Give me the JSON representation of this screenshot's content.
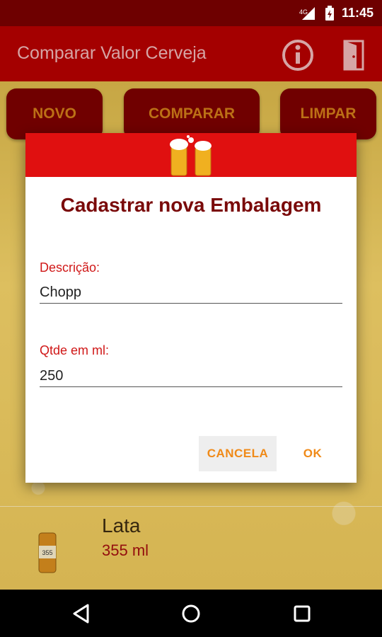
{
  "status_bar": {
    "network": "4G",
    "time": "11:45"
  },
  "app_bar": {
    "title": "Comparar Valor Cerveja",
    "info_icon": "info-icon",
    "exit_icon": "exit-door-icon"
  },
  "actions": {
    "novo": "NOVO",
    "comparar": "COMPARAR",
    "limpar": "LIMPAR"
  },
  "list": {
    "items": [
      {
        "title": "Lata",
        "subtitle": "355 ml",
        "can_label": "355"
      }
    ]
  },
  "dialog": {
    "title": "Cadastrar nova Embalagem",
    "descricao_label": "Descrição:",
    "descricao_value": "Chopp",
    "qtde_label": "Qtde em ml:",
    "qtde_value": "250",
    "cancel_label": "CANCELA",
    "ok_label": "OK"
  },
  "colors": {
    "app_bar": "#b20000",
    "dialog_header": "#e01010",
    "accent_orange": "#f08a18",
    "label_red": "#d01818"
  }
}
